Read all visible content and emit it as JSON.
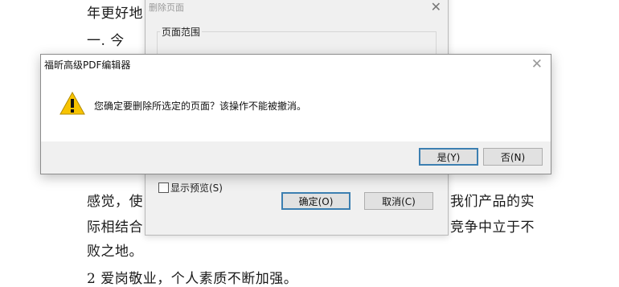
{
  "document": {
    "lines": [
      "年更好地",
      "一.      今",
      "感觉，使",
      "我们产品的实",
      "际相结合",
      "竞争中立于不",
      "败之地。",
      "2   爱岗敬业，个人素质不断加强。"
    ]
  },
  "delete_dialog": {
    "title": "删除页面",
    "close": "✕",
    "page_range_label": "页面范围",
    "preview_label": "显示预览(S)",
    "ok_label": "确定(O)",
    "cancel_label": "取消(C)"
  },
  "confirm_dialog": {
    "title": "福昕高级PDF编辑器",
    "close": "✕",
    "message": "您确定要删除所选定的页面？该操作不能被撤消。",
    "yes_label": "是(Y)",
    "no_label": "否(N)",
    "icon": "warning-icon"
  }
}
